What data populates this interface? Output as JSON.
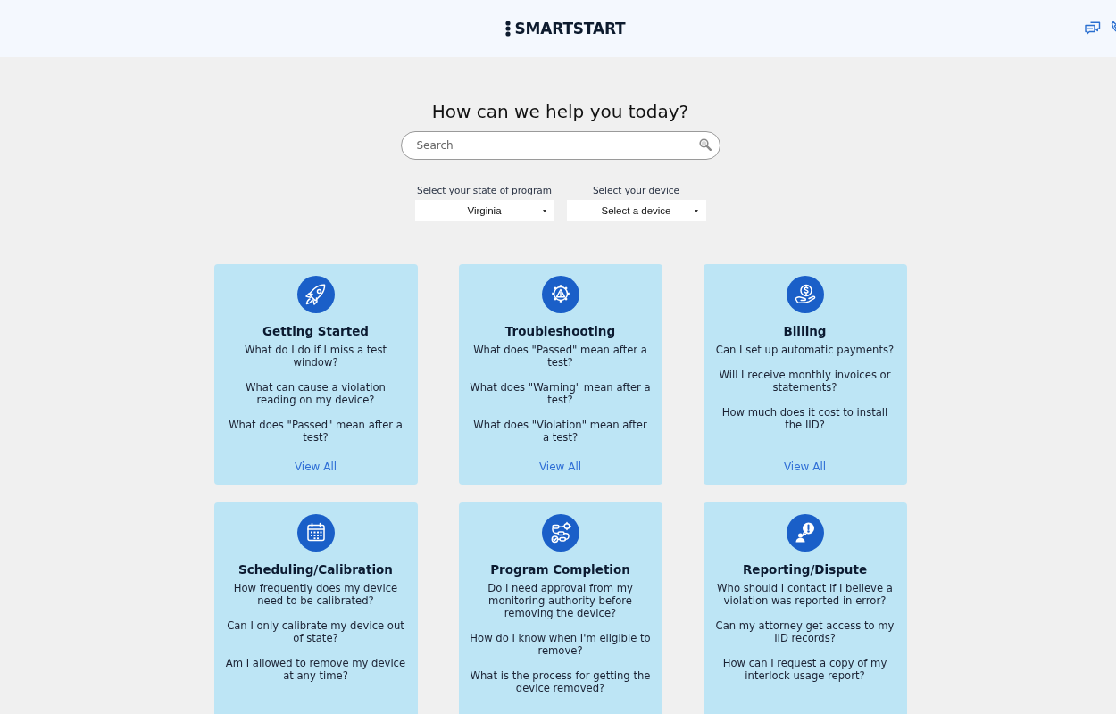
{
  "header": {
    "logo": "SMARTSTART"
  },
  "hero": {
    "title": "How can we help you today?",
    "search": {
      "placeholder": "Search"
    }
  },
  "filters": [
    {
      "label": "Select your state of program",
      "value": "Virginia"
    },
    {
      "label": "Select your device",
      "value": "Select a device"
    }
  ],
  "categories": [
    {
      "title": "Getting Started",
      "questions": [
        "What do I do if I miss a test window?",
        "What can cause a violation reading on my device?",
        "What does \"Passed\" mean after a test?"
      ],
      "link": "View All"
    },
    {
      "title": "Troubleshooting",
      "questions": [
        "What does \"Passed\" mean after a test?",
        "What does \"Warning\" mean after a test?",
        "What does \"Violation\" mean after a test?"
      ],
      "link": "View All"
    },
    {
      "title": "Billing",
      "questions": [
        "Can I set up automatic payments?",
        "Will I receive monthly invoices or statements?",
        "How much does it cost to install the IID?"
      ],
      "link": "View All"
    },
    {
      "title": "Scheduling/Calibration",
      "questions": [
        "How frequently does my device need to be calibrated?",
        "Can I only calibrate my device out of state?",
        "Am I allowed to remove my device at any time?"
      ]
    },
    {
      "title": "Program Completion",
      "questions": [
        "Do I need approval from my monitoring authority before removing the device?",
        "How do I know when I'm eligible to remove?",
        "What is the process for getting the device removed?"
      ]
    },
    {
      "title": "Reporting/Dispute",
      "questions": [
        "Who should I contact if I believe a violation was reported in error?",
        "Can my attorney get access to my IID records?",
        "How can I request a copy of my interlock usage report?"
      ]
    }
  ]
}
